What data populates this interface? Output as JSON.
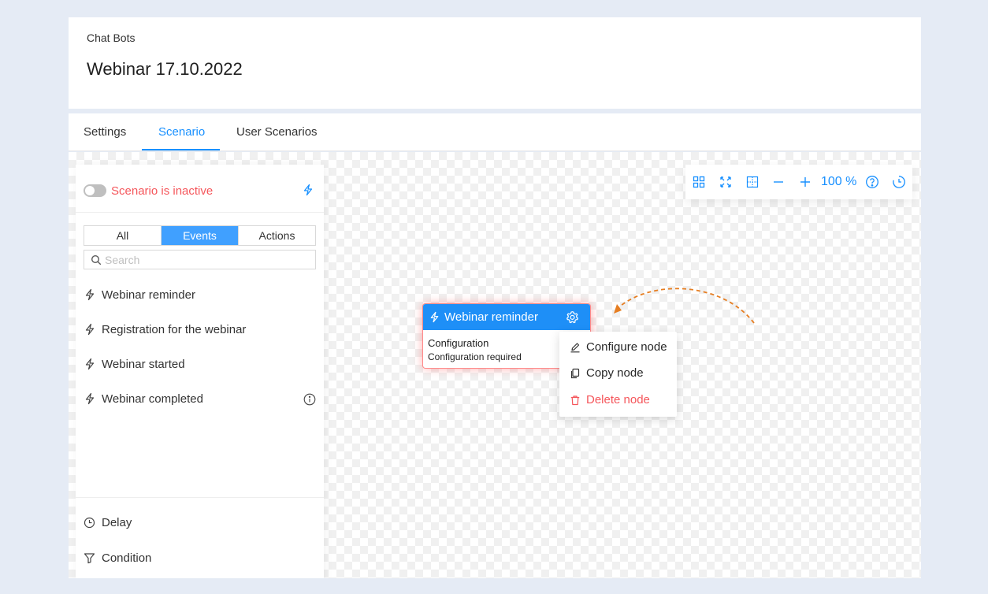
{
  "header": {
    "breadcrumb": "Chat Bots",
    "title": "Webinar 17.10.2022"
  },
  "tabs": [
    {
      "label": "Settings",
      "active": false
    },
    {
      "label": "Scenario",
      "active": true
    },
    {
      "label": "User Scenarios",
      "active": false
    }
  ],
  "sidebar": {
    "status_text": "Scenario is inactive",
    "toggle_on": false,
    "filters": [
      {
        "label": "All",
        "active": false
      },
      {
        "label": "Events",
        "active": true
      },
      {
        "label": "Actions",
        "active": false
      }
    ],
    "search_placeholder": "Search",
    "search_value": "",
    "events": [
      {
        "label": "Webinar reminder",
        "icon": "bolt-icon"
      },
      {
        "label": "Registration for the webinar",
        "icon": "bolt-icon"
      },
      {
        "label": "Webinar started",
        "icon": "bolt-icon"
      },
      {
        "label": "Webinar completed",
        "icon": "bolt-icon",
        "has_info": true
      }
    ],
    "actions": [
      {
        "label": "Delay",
        "icon": "clock-icon"
      },
      {
        "label": "Condition",
        "icon": "filter-icon"
      }
    ]
  },
  "toolbar": {
    "zoom": "100 %",
    "buttons": [
      "grid-icon",
      "fullscreen-icon",
      "frame-icon",
      "zoom-out-icon",
      "zoom-in-icon",
      "help-icon",
      "history-icon"
    ]
  },
  "node": {
    "title": "Webinar reminder",
    "label": "Configuration",
    "status": "Configuration required"
  },
  "context_menu": {
    "items": [
      {
        "label": "Configure node",
        "icon": "edit-icon"
      },
      {
        "label": "Copy node",
        "icon": "copy-icon"
      },
      {
        "label": "Delete node",
        "icon": "trash-icon",
        "danger": true
      }
    ]
  },
  "colors": {
    "accent": "#1890ff",
    "danger": "#f5565b",
    "node_header": "#1e8ff7",
    "connector": "#e67e22"
  }
}
